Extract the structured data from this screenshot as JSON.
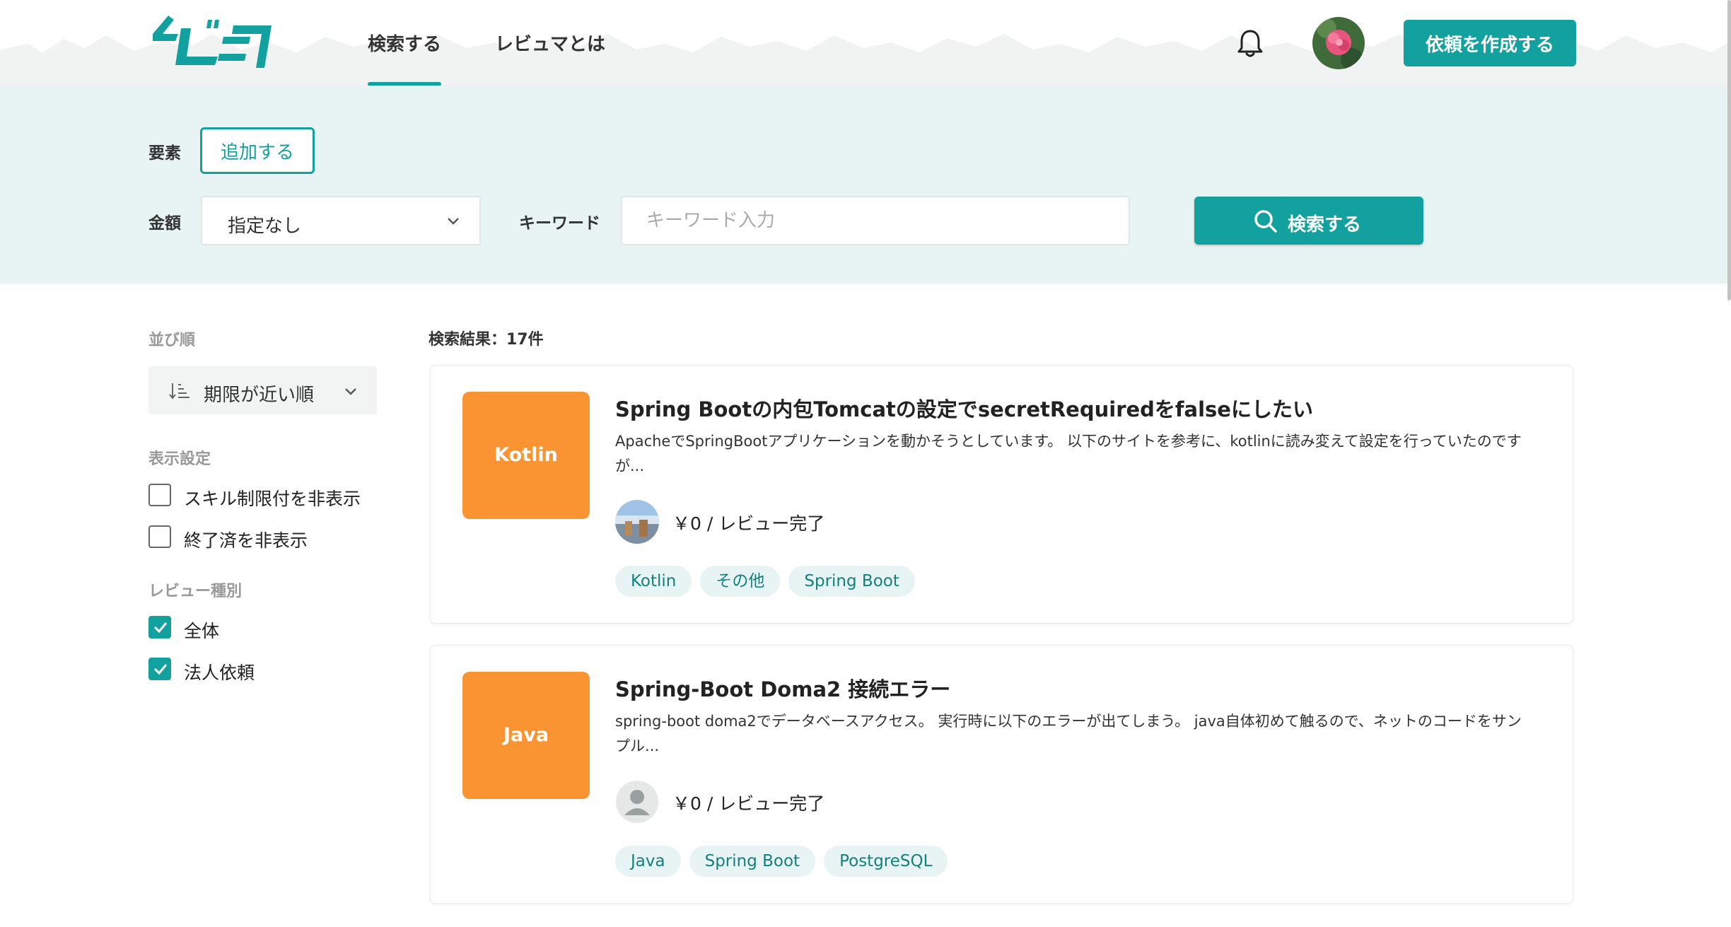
{
  "header": {
    "logo_icon": "reviewer-logo",
    "nav": [
      {
        "label": "検索する",
        "active": true
      },
      {
        "label": "レビュマとは",
        "active": false
      }
    ],
    "bell_icon": "bell-icon",
    "create_button": "依頼を作成する"
  },
  "search": {
    "element_label": "要素",
    "add_button": "追加する",
    "price_label": "金額",
    "price_selected": "指定なし",
    "keyword_label": "キーワード",
    "keyword_placeholder": "キーワード入力",
    "keyword_value": "",
    "search_button": "検索する"
  },
  "sidebar": {
    "sort_heading": "並び順",
    "sort_selected": "期限が近い順",
    "display_heading": "表示設定",
    "display_options": [
      {
        "label": "スキル制限付を非表示",
        "checked": false
      },
      {
        "label": "終了済を非表示",
        "checked": false
      }
    ],
    "type_heading": "レビュー種別",
    "type_options": [
      {
        "label": "全体",
        "checked": true
      },
      {
        "label": "法人依頼",
        "checked": true
      }
    ]
  },
  "results": {
    "count_text": "検索結果：17件",
    "items": [
      {
        "thumb": "Kotlin",
        "title": "Spring Bootの内包Tomcatの設定でsecretRequiredをfalseにしたい",
        "description": "ApacheでSpringBootアプリケーションを動かそうとしています。 以下のサイトを参考に、kotlinに読み変えて設定を行っていたのですが...",
        "price_status": "￥0 / レビュー完了",
        "tags": [
          "Kotlin",
          "その他",
          "Spring Boot"
        ]
      },
      {
        "thumb": "Java",
        "title": "Spring-Boot Doma2 接続エラー",
        "description": "spring-boot doma2でデータベースアクセス。 実行時に以下のエラーが出てしまう。 java自体初めて触るので、ネットのコードをサンプル...",
        "price_status": "￥0 / レビュー完了",
        "tags": [
          "Java",
          "Spring Boot",
          "PostgreSQL"
        ]
      }
    ]
  },
  "colors": {
    "accent": "#13a19f",
    "panel": "#e8f4f3",
    "thumb": "#fa9331"
  }
}
